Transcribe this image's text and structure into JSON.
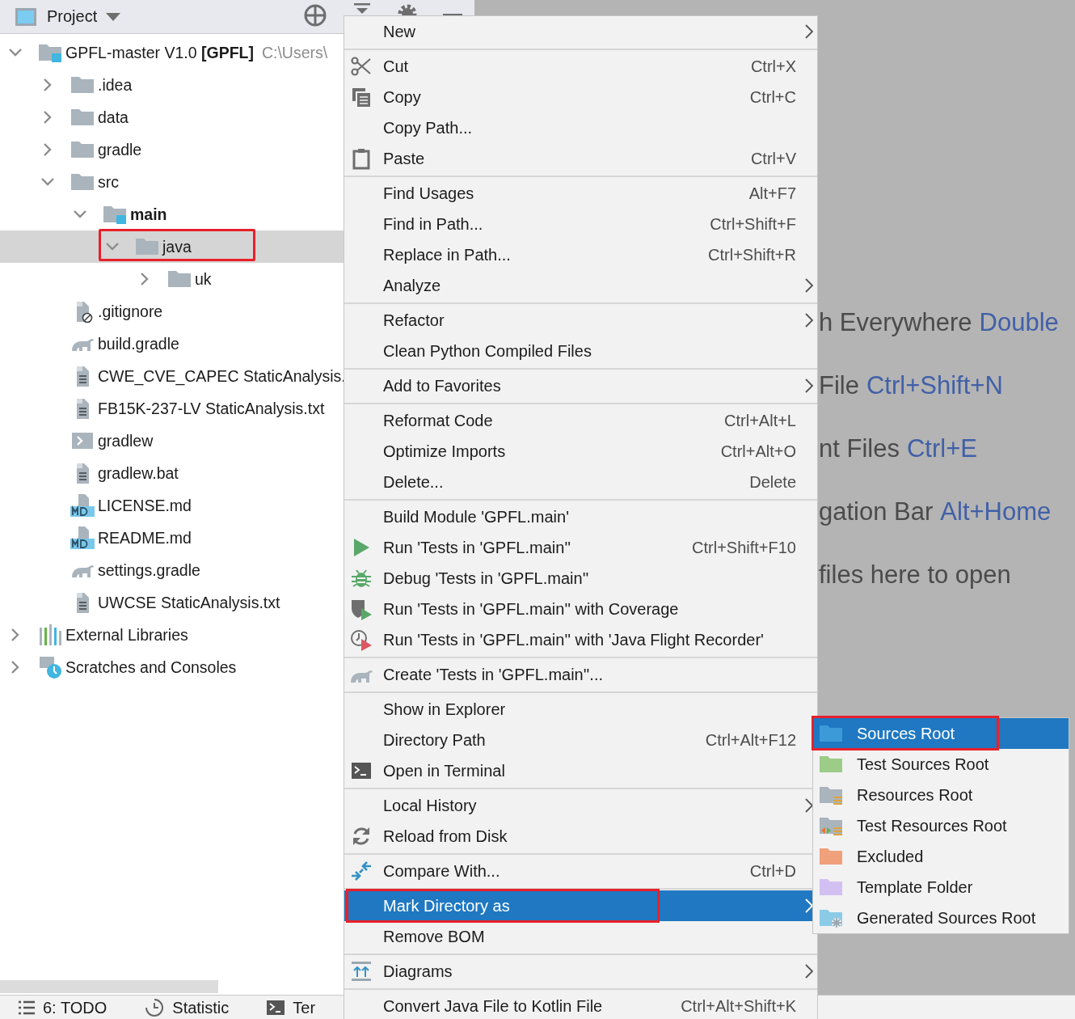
{
  "tool_window": {
    "title": "Project"
  },
  "tree": [
    {
      "label": "GPFL-master V1.0 **[GPFL]**",
      "path": "C:\\Users\\",
      "kind": "module",
      "expanded": true,
      "selected": false,
      "annotated": false,
      "children": [
        {
          "label": ".idea",
          "kind": "folder",
          "expanded": false,
          "selected": false,
          "annotated": false
        },
        {
          "label": "data",
          "kind": "folder",
          "expanded": false,
          "selected": false,
          "annotated": false
        },
        {
          "label": "gradle",
          "kind": "folder",
          "expanded": false,
          "selected": false,
          "annotated": false
        },
        {
          "label": "src",
          "kind": "folder",
          "expanded": true,
          "selected": false,
          "annotated": false,
          "children": [
            {
              "label": "main",
              "kind": "source_set",
              "expanded": true,
              "selected": false,
              "annotated": false,
              "children": [
                {
                  "label": "java",
                  "kind": "folder",
                  "expanded": true,
                  "selected": true,
                  "annotated": true,
                  "children": [
                    {
                      "label": "uk",
                      "kind": "folder",
                      "expanded": false,
                      "selected": false,
                      "annotated": false
                    }
                  ]
                }
              ]
            }
          ]
        },
        {
          "label": ".gitignore",
          "kind": "ignore_file",
          "selected": false,
          "annotated": false
        },
        {
          "label": "build.gradle",
          "kind": "gradle",
          "selected": false,
          "annotated": false
        },
        {
          "label": "CWE_CVE_CAPEC StaticAnalysis.",
          "kind": "text",
          "selected": false,
          "annotated": false
        },
        {
          "label": "FB15K-237-LV StaticAnalysis.txt",
          "kind": "text",
          "selected": false,
          "annotated": false
        },
        {
          "label": "gradlew",
          "kind": "shell",
          "selected": false,
          "annotated": false
        },
        {
          "label": "gradlew.bat",
          "kind": "text",
          "selected": false,
          "annotated": false
        },
        {
          "label": "LICENSE.md",
          "kind": "markdown",
          "selected": false,
          "annotated": false
        },
        {
          "label": "README.md",
          "kind": "markdown",
          "selected": false,
          "annotated": false
        },
        {
          "label": "settings.gradle",
          "kind": "gradle",
          "selected": false,
          "annotated": false
        },
        {
          "label": "UWCSE StaticAnalysis.txt",
          "kind": "text",
          "selected": false,
          "annotated": false
        }
      ]
    },
    {
      "label": "External Libraries",
      "kind": "libraries",
      "expanded": false,
      "selected": false,
      "annotated": false
    },
    {
      "label": "Scratches and Consoles",
      "kind": "scratches",
      "expanded": false,
      "selected": false,
      "annotated": false
    }
  ],
  "menu": {
    "groups": [
      [
        {
          "label": "New",
          "submenu": true,
          "selected": false,
          "annotated": false
        }
      ],
      [
        {
          "label": "Cut",
          "shortcut": "Ctrl+X",
          "submenu": false,
          "selected": false,
          "annotated": false
        },
        {
          "label": "Copy",
          "shortcut": "Ctrl+C",
          "submenu": false,
          "selected": false,
          "annotated": false
        },
        {
          "label": "Copy Path...",
          "submenu": false,
          "selected": false,
          "annotated": false
        },
        {
          "label": "Paste",
          "shortcut": "Ctrl+V",
          "submenu": false,
          "selected": false,
          "annotated": false
        }
      ],
      [
        {
          "label": "Find Usages",
          "shortcut": "Alt+F7",
          "submenu": false,
          "selected": false,
          "annotated": false
        },
        {
          "label": "Find in Path...",
          "shortcut": "Ctrl+Shift+F",
          "submenu": false,
          "selected": false,
          "annotated": false
        },
        {
          "label": "Replace in Path...",
          "shortcut": "Ctrl+Shift+R",
          "submenu": false,
          "selected": false,
          "annotated": false
        },
        {
          "label": "Analyze",
          "submenu": true,
          "selected": false,
          "annotated": false
        }
      ],
      [
        {
          "label": "Refactor",
          "submenu": true,
          "selected": false,
          "annotated": false
        },
        {
          "label": "Clean Python Compiled Files",
          "submenu": false,
          "selected": false,
          "annotated": false
        }
      ],
      [
        {
          "label": "Add to Favorites",
          "submenu": true,
          "selected": false,
          "annotated": false
        }
      ],
      [
        {
          "label": "Reformat Code",
          "shortcut": "Ctrl+Alt+L",
          "submenu": false,
          "selected": false,
          "annotated": false
        },
        {
          "label": "Optimize Imports",
          "shortcut": "Ctrl+Alt+O",
          "submenu": false,
          "selected": false,
          "annotated": false
        },
        {
          "label": "Delete...",
          "shortcut": "Delete",
          "submenu": false,
          "selected": false,
          "annotated": false
        }
      ],
      [
        {
          "label": "Build Module 'GPFL.main'",
          "submenu": false,
          "selected": false,
          "annotated": false
        },
        {
          "label": "Run 'Tests in 'GPFL.main''",
          "shortcut": "Ctrl+Shift+F10",
          "submenu": false,
          "selected": false,
          "annotated": false
        },
        {
          "label": "Debug 'Tests in 'GPFL.main''",
          "submenu": false,
          "selected": false,
          "annotated": false
        },
        {
          "label": "Run 'Tests in 'GPFL.main'' with Coverage",
          "submenu": false,
          "selected": false,
          "annotated": false
        },
        {
          "label": "Run 'Tests in 'GPFL.main'' with 'Java Flight Recorder'",
          "submenu": false,
          "selected": false,
          "annotated": false
        }
      ],
      [
        {
          "label": "Create 'Tests in 'GPFL.main''...",
          "submenu": false,
          "selected": false,
          "annotated": false
        }
      ],
      [
        {
          "label": "Show in Explorer",
          "submenu": false,
          "selected": false,
          "annotated": false
        },
        {
          "label": "Directory Path",
          "shortcut": "Ctrl+Alt+F12",
          "submenu": false,
          "selected": false,
          "annotated": false
        },
        {
          "label": "Open in Terminal",
          "submenu": false,
          "selected": false,
          "annotated": false
        }
      ],
      [
        {
          "label": "Local History",
          "submenu": true,
          "selected": false,
          "annotated": false
        },
        {
          "label": "Reload from Disk",
          "submenu": false,
          "selected": false,
          "annotated": false
        }
      ],
      [
        {
          "label": "Compare With...",
          "shortcut": "Ctrl+D",
          "submenu": false,
          "selected": false,
          "annotated": false
        }
      ],
      [
        {
          "label": "Mark Directory as",
          "submenu": true,
          "selected": true,
          "annotated": true
        },
        {
          "label": "Remove BOM",
          "submenu": false,
          "selected": false,
          "annotated": false
        }
      ],
      [
        {
          "label": "Diagrams",
          "submenu": true,
          "selected": false,
          "annotated": false
        }
      ],
      [
        {
          "label": "Convert Java File to Kotlin File",
          "shortcut": "Ctrl+Alt+Shift+K",
          "submenu": false,
          "selected": false,
          "annotated": false
        }
      ]
    ]
  },
  "submenu": {
    "items": [
      {
        "label": "Sources Root",
        "color": "#3d9ad8",
        "selected": true,
        "annotated": true
      },
      {
        "label": "Test Sources Root",
        "color": "#9ccc87",
        "selected": false,
        "annotated": false
      },
      {
        "label": "Resources Root",
        "color": "#aab4bd",
        "selected": false,
        "annotated": false
      },
      {
        "label": "Test Resources Root",
        "color": "#aab4bd",
        "selected": false,
        "annotated": false
      },
      {
        "label": "Excluded",
        "color": "#f0a07a",
        "selected": false,
        "annotated": false
      },
      {
        "label": "Template Folder",
        "color": "#d2c0f2",
        "selected": false,
        "annotated": false
      },
      {
        "label": "Generated Sources Root",
        "color": "#8ccbe6",
        "selected": false,
        "annotated": false
      }
    ]
  },
  "editor_hints": [
    {
      "text": "h Everywhere",
      "shortcut": "Double"
    },
    {
      "text": "File",
      "shortcut": "Ctrl+Shift+N"
    },
    {
      "text": "nt Files",
      "shortcut": "Ctrl+E"
    },
    {
      "text": "gation Bar",
      "shortcut": "Alt+Home"
    },
    {
      "text": "files here to open"
    }
  ],
  "bottom_bar": {
    "tabs": [
      {
        "label": "6: TODO"
      },
      {
        "label": "Statistic"
      },
      {
        "label": "Ter"
      }
    ]
  }
}
